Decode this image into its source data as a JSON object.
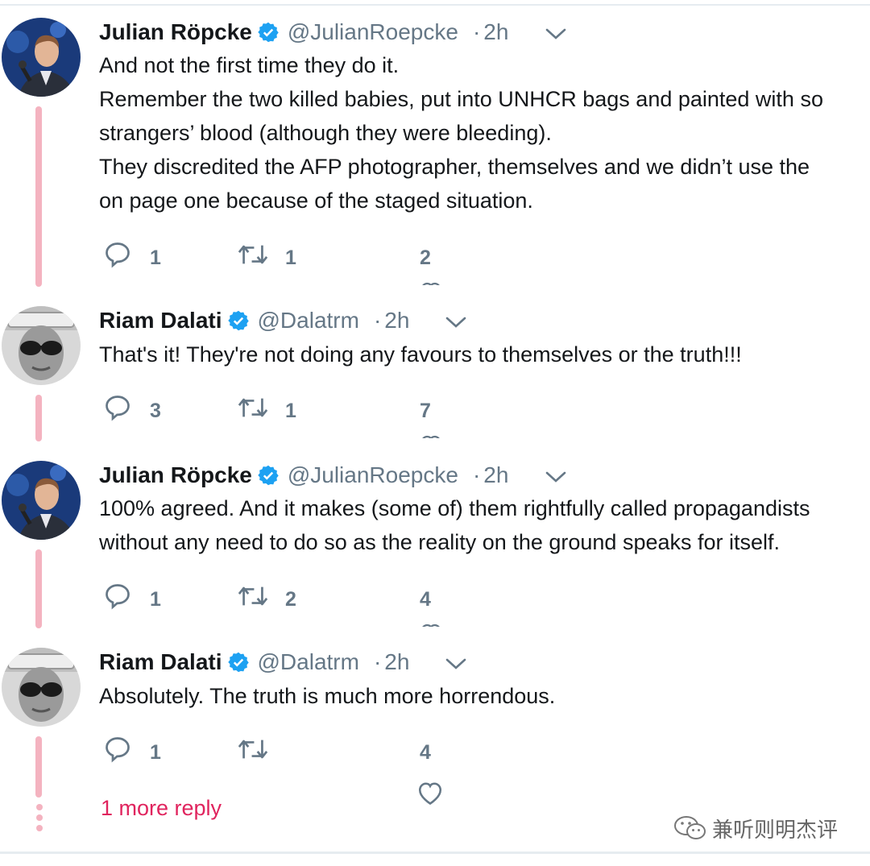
{
  "tweets": [
    {
      "name": "Julian Röpcke",
      "handle": "@JulianRoepcke",
      "dot": "·",
      "time": "2h",
      "lines": [
        "And not the first time they do it.",
        "Remember the two killed babies, put into UNHCR bags and painted with so",
        "strangers’ blood (although they were bleeding).",
        "They discredited the AFP photographer, themselves and we didn’t use the",
        "on page one because of the staged situation."
      ],
      "replies": "1",
      "retweets": "1",
      "likes": "2"
    },
    {
      "name": "Riam Dalati",
      "handle": "@Dalatrm",
      "dot": "·",
      "time": "2h",
      "lines": [
        "That's it! They're not doing any favours to themselves or the truth!!!"
      ],
      "replies": "3",
      "retweets": "1",
      "likes": "7"
    },
    {
      "name": "Julian Röpcke",
      "handle": "@JulianRoepcke",
      "dot": "·",
      "time": "2h",
      "lines": [
        "100% agreed. And it makes (some of) them rightfully called propagandists",
        "without any need to do so as the reality on the ground speaks for itself."
      ],
      "replies": "1",
      "retweets": "2",
      "likes": "4"
    },
    {
      "name": "Riam Dalati",
      "handle": "@Dalatrm",
      "dot": "·",
      "time": "2h",
      "lines": [
        "Absolutely. The truth is much more horrendous."
      ],
      "replies": "1",
      "retweets": "",
      "likes": "4"
    }
  ],
  "more_reply": "1 more reply",
  "watermark": "兼听则明杰评",
  "colors": {
    "name": "#14171a",
    "meta": "#657786",
    "verified": "#1da1f2",
    "thread": "#f4b3c0",
    "more_reply": "#e0245e"
  },
  "icons": [
    "reply-icon",
    "retweet-icon",
    "like-icon",
    "verified-icon",
    "chevron-down-icon",
    "wechat-icon"
  ]
}
